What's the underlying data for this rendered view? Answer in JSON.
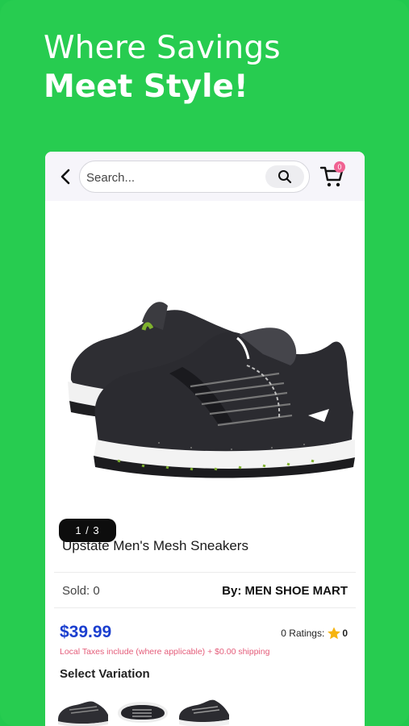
{
  "promo": {
    "line1": "Where Savings",
    "line2": "Meet Style!"
  },
  "header": {
    "back_icon": "chevron-left-icon",
    "search_placeholder": "Search...",
    "search_icon": "search-icon",
    "cart_icon": "cart-icon",
    "cart_count": "0"
  },
  "product": {
    "image_pager": "1 / 3",
    "title": "Upstate Men's Mesh Sneakers",
    "sold": "Sold: 0",
    "seller": "By: MEN SHOE MART",
    "price": "$39.99",
    "ratings_label": "0 Ratings:",
    "ratings_count": "0",
    "taxes_note": "Local Taxes include (where applicable) + $0.00 shipping",
    "variation_title": "Select Variation"
  },
  "colors": {
    "brand_green": "#27cc50",
    "price_blue": "#1b3fcf",
    "tax_pink": "#e45d7a",
    "badge_pink": "#f06292",
    "star_yellow": "#f6b40e"
  }
}
